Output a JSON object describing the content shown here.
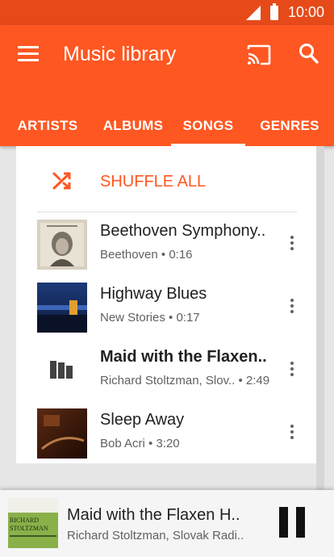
{
  "status_bar": {
    "time": "10:00",
    "signal_icon": "signal-icon",
    "battery_icon": "battery-icon"
  },
  "app_bar": {
    "title": "Music library",
    "menu_icon": "menu-icon",
    "cast_icon": "cast-icon",
    "search_icon": "search-icon",
    "background": "#ff5722",
    "status_background": "#e64a19"
  },
  "tabs": [
    {
      "label": "ARTISTS",
      "active": false
    },
    {
      "label": "ALBUMS",
      "active": false
    },
    {
      "label": "SONGS",
      "active": true
    },
    {
      "label": "GENRES",
      "active": false
    }
  ],
  "shuffle": {
    "label": "SHUFFLE ALL",
    "icon": "shuffle-icon",
    "color": "#ff5722"
  },
  "songs": [
    {
      "title": "Beethoven Symphony..",
      "subtitle": "Beethoven • 0:16",
      "art": "beethoven-album-art",
      "playing": false
    },
    {
      "title": "Highway Blues",
      "subtitle": "New Stories • 0:17",
      "art": "highway-blues-album-art",
      "playing": false
    },
    {
      "title": "Maid with the Flaxen..",
      "subtitle": "Richard Stoltzman, Slov..  • 2:49",
      "art": "now-playing-equalizer-icon",
      "playing": true
    },
    {
      "title": "Sleep Away",
      "subtitle": "Bob Acri • 3:20",
      "art": "sleep-away-album-art",
      "playing": false
    }
  ],
  "now_playing": {
    "title": "Maid with the Flaxen H..",
    "subtitle": "Richard Stoltzman, Slovak Radi..",
    "art_text": "RICHARD STOLTZMAN",
    "pause_icon": "pause-icon"
  }
}
